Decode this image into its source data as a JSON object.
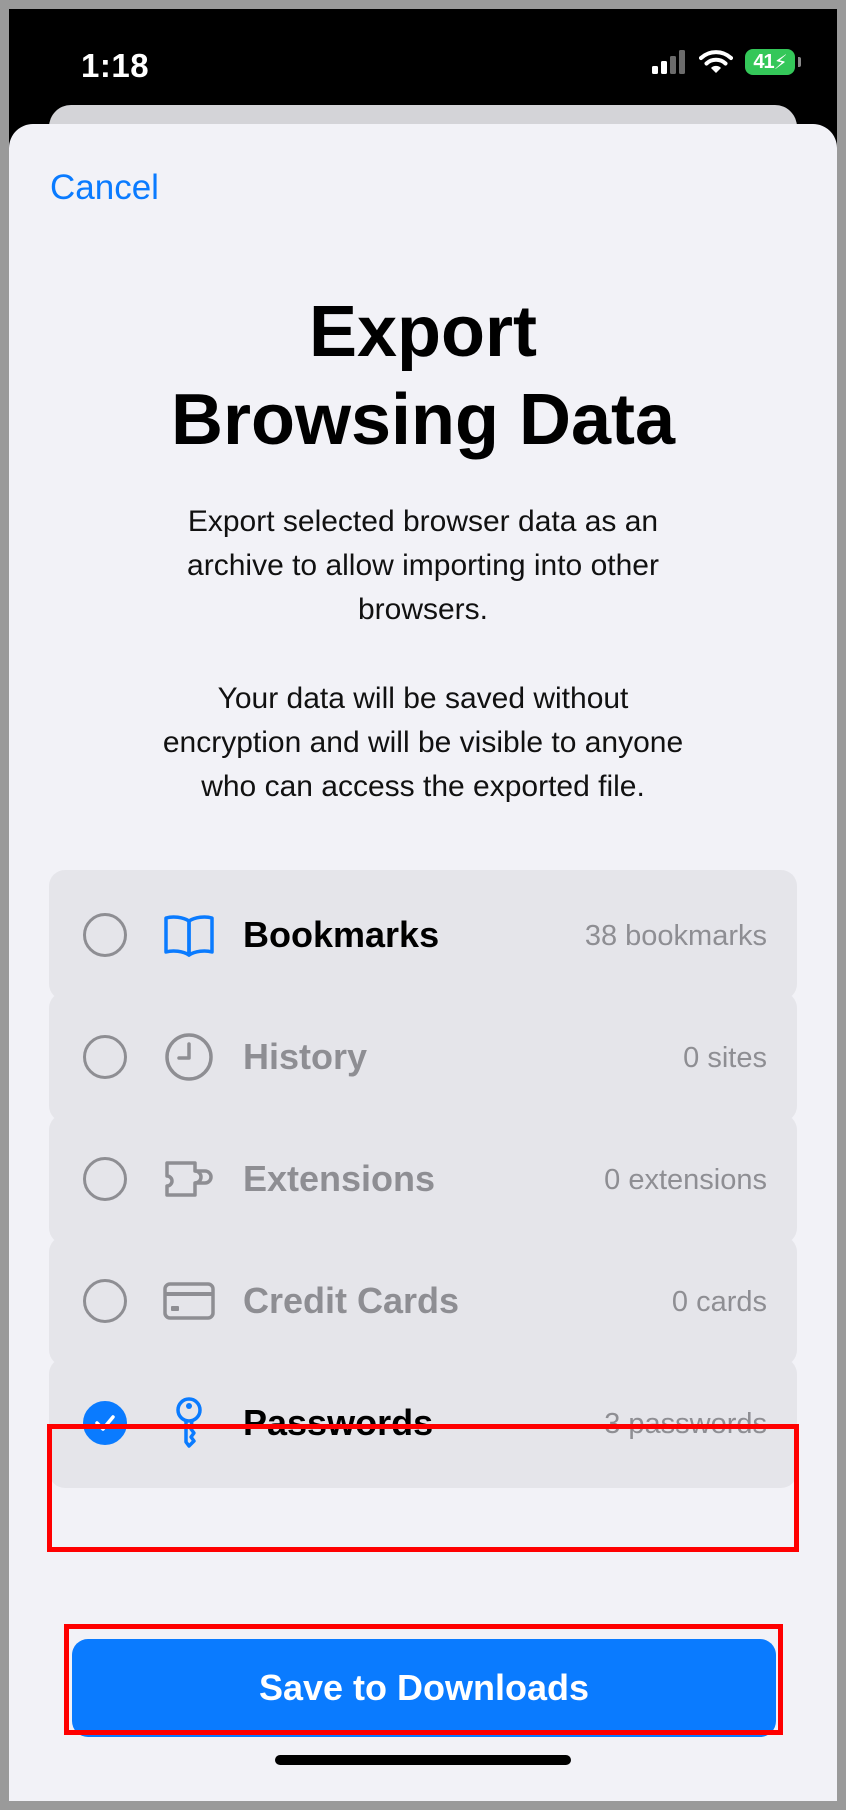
{
  "status_bar": {
    "time": "1:18",
    "battery": "41"
  },
  "sheet": {
    "cancel_label": "Cancel",
    "title": "Export\nBrowsing Data",
    "description": "Export selected browser data as an\narchive to allow importing into other\nbrowsers.",
    "warning": "Your data will be saved without\nencryption and will be visible to anyone\nwho can access the exported file."
  },
  "options": [
    {
      "label": "Bookmarks",
      "count": "38 bookmarks",
      "icon": "book-icon",
      "checked": false,
      "enabled": true
    },
    {
      "label": "History",
      "count": "0 sites",
      "icon": "clock-icon",
      "checked": false,
      "enabled": false
    },
    {
      "label": "Extensions",
      "count": "0 extensions",
      "icon": "puzzle-icon",
      "checked": false,
      "enabled": false
    },
    {
      "label": "Credit Cards",
      "count": "0 cards",
      "icon": "credit-card-icon",
      "checked": false,
      "enabled": false
    },
    {
      "label": "Passwords",
      "count": "3 passwords",
      "icon": "key-icon",
      "checked": true,
      "enabled": true
    }
  ],
  "save_button_label": "Save to Downloads",
  "colors": {
    "accent": "#0a7bff",
    "highlight": "#ff0000",
    "battery": "#34c759"
  }
}
